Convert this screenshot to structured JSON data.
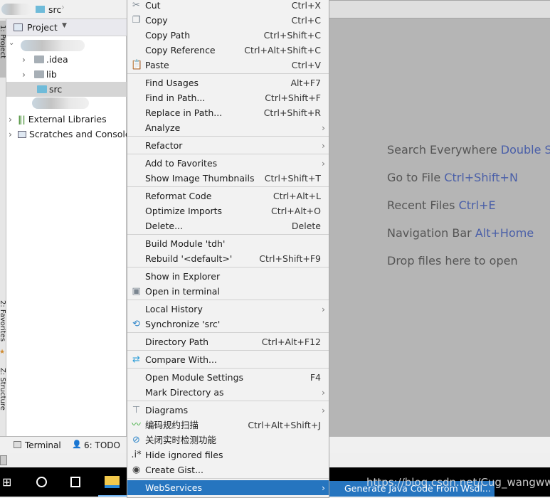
{
  "navbar": {
    "crumb": "src"
  },
  "left_tabs": {
    "project": "1: Project",
    "favorites": "2: Favorites",
    "structure": "Z: Structure"
  },
  "project_panel": {
    "title": "Project",
    "tree": [
      {
        "label": ".idea",
        "kind": "folder",
        "expandable": true
      },
      {
        "label": "lib",
        "kind": "folder",
        "expandable": true
      },
      {
        "label": "src",
        "kind": "source-folder",
        "selected": true
      },
      {
        "label": "External Libraries",
        "kind": "libraries",
        "expandable": true
      },
      {
        "label": "Scratches and Consoles",
        "kind": "scratches",
        "expandable": true
      }
    ]
  },
  "editor_hints": [
    {
      "text": "Search Everywhere",
      "key": "Double Shift"
    },
    {
      "text": "Go to File",
      "key": "Ctrl+Shift+N"
    },
    {
      "text": "Recent Files",
      "key": "Ctrl+E"
    },
    {
      "text": "Navigation Bar",
      "key": "Alt+Home"
    },
    {
      "text": "Drop files here to open",
      "key": ""
    }
  ],
  "context_menu": [
    {
      "label": "Cut",
      "shortcut": "Ctrl+X",
      "icon": "scissors-icon"
    },
    {
      "label": "Copy",
      "shortcut": "Ctrl+C",
      "icon": "copy-icon"
    },
    {
      "label": "Copy Path",
      "shortcut": "Ctrl+Shift+C"
    },
    {
      "label": "Copy Reference",
      "shortcut": "Ctrl+Alt+Shift+C"
    },
    {
      "label": "Paste",
      "shortcut": "Ctrl+V",
      "icon": "paste-icon"
    },
    {
      "sep": true
    },
    {
      "label": "Find Usages",
      "shortcut": "Alt+F7"
    },
    {
      "label": "Find in Path...",
      "shortcut": "Ctrl+Shift+F"
    },
    {
      "label": "Replace in Path...",
      "shortcut": "Ctrl+Shift+R"
    },
    {
      "label": "Analyze",
      "submenu": true
    },
    {
      "sep": true
    },
    {
      "label": "Refactor",
      "submenu": true
    },
    {
      "sep": true
    },
    {
      "label": "Add to Favorites",
      "submenu": true
    },
    {
      "label": "Show Image Thumbnails",
      "shortcut": "Ctrl+Shift+T"
    },
    {
      "sep": true
    },
    {
      "label": "Reformat Code",
      "shortcut": "Ctrl+Alt+L"
    },
    {
      "label": "Optimize Imports",
      "shortcut": "Ctrl+Alt+O"
    },
    {
      "label": "Delete...",
      "shortcut": "Delete"
    },
    {
      "sep": true
    },
    {
      "label": "Build Module 'tdh'"
    },
    {
      "label": "Rebuild '<default>'",
      "shortcut": "Ctrl+Shift+F9"
    },
    {
      "sep": true
    },
    {
      "label": "Show in Explorer"
    },
    {
      "label": "Open in terminal",
      "icon": "terminal-icon"
    },
    {
      "sep": true
    },
    {
      "label": "Local History",
      "submenu": true
    },
    {
      "label": "Synchronize 'src'",
      "icon": "sync-icon"
    },
    {
      "sep": true
    },
    {
      "label": "Directory Path",
      "shortcut": "Ctrl+Alt+F12"
    },
    {
      "sep": true
    },
    {
      "label": "Compare With...",
      "icon": "compare-icon"
    },
    {
      "sep": true
    },
    {
      "label": "Open Module Settings",
      "shortcut": "F4"
    },
    {
      "label": "Mark Directory as",
      "submenu": true
    },
    {
      "sep": true
    },
    {
      "label": "Diagrams",
      "submenu": true,
      "icon": "diagram-icon"
    },
    {
      "label": "编码规约扫描",
      "shortcut": "Ctrl+Alt+Shift+J",
      "icon": "scan-icon"
    },
    {
      "label": "关闭实时检测功能",
      "icon": "disable-icon"
    },
    {
      "label": "Hide ignored files",
      "icon": "ignored-icon"
    },
    {
      "label": "Create Gist...",
      "icon": "github-icon"
    },
    {
      "sep": true
    },
    {
      "label": "WebServices",
      "submenu": true,
      "selected": true
    }
  ],
  "submenu": {
    "label": "Generate Java Code From Wsdl..."
  },
  "statusbar": {
    "terminal": "Terminal",
    "todo": "6: TODO"
  },
  "watermark": "https://blog.csdn.net/Cug_wangww",
  "colors": {
    "selection": "#2675bf",
    "editor_bg": "#b5b5b5",
    "hint_key": "#4a5fa8"
  }
}
